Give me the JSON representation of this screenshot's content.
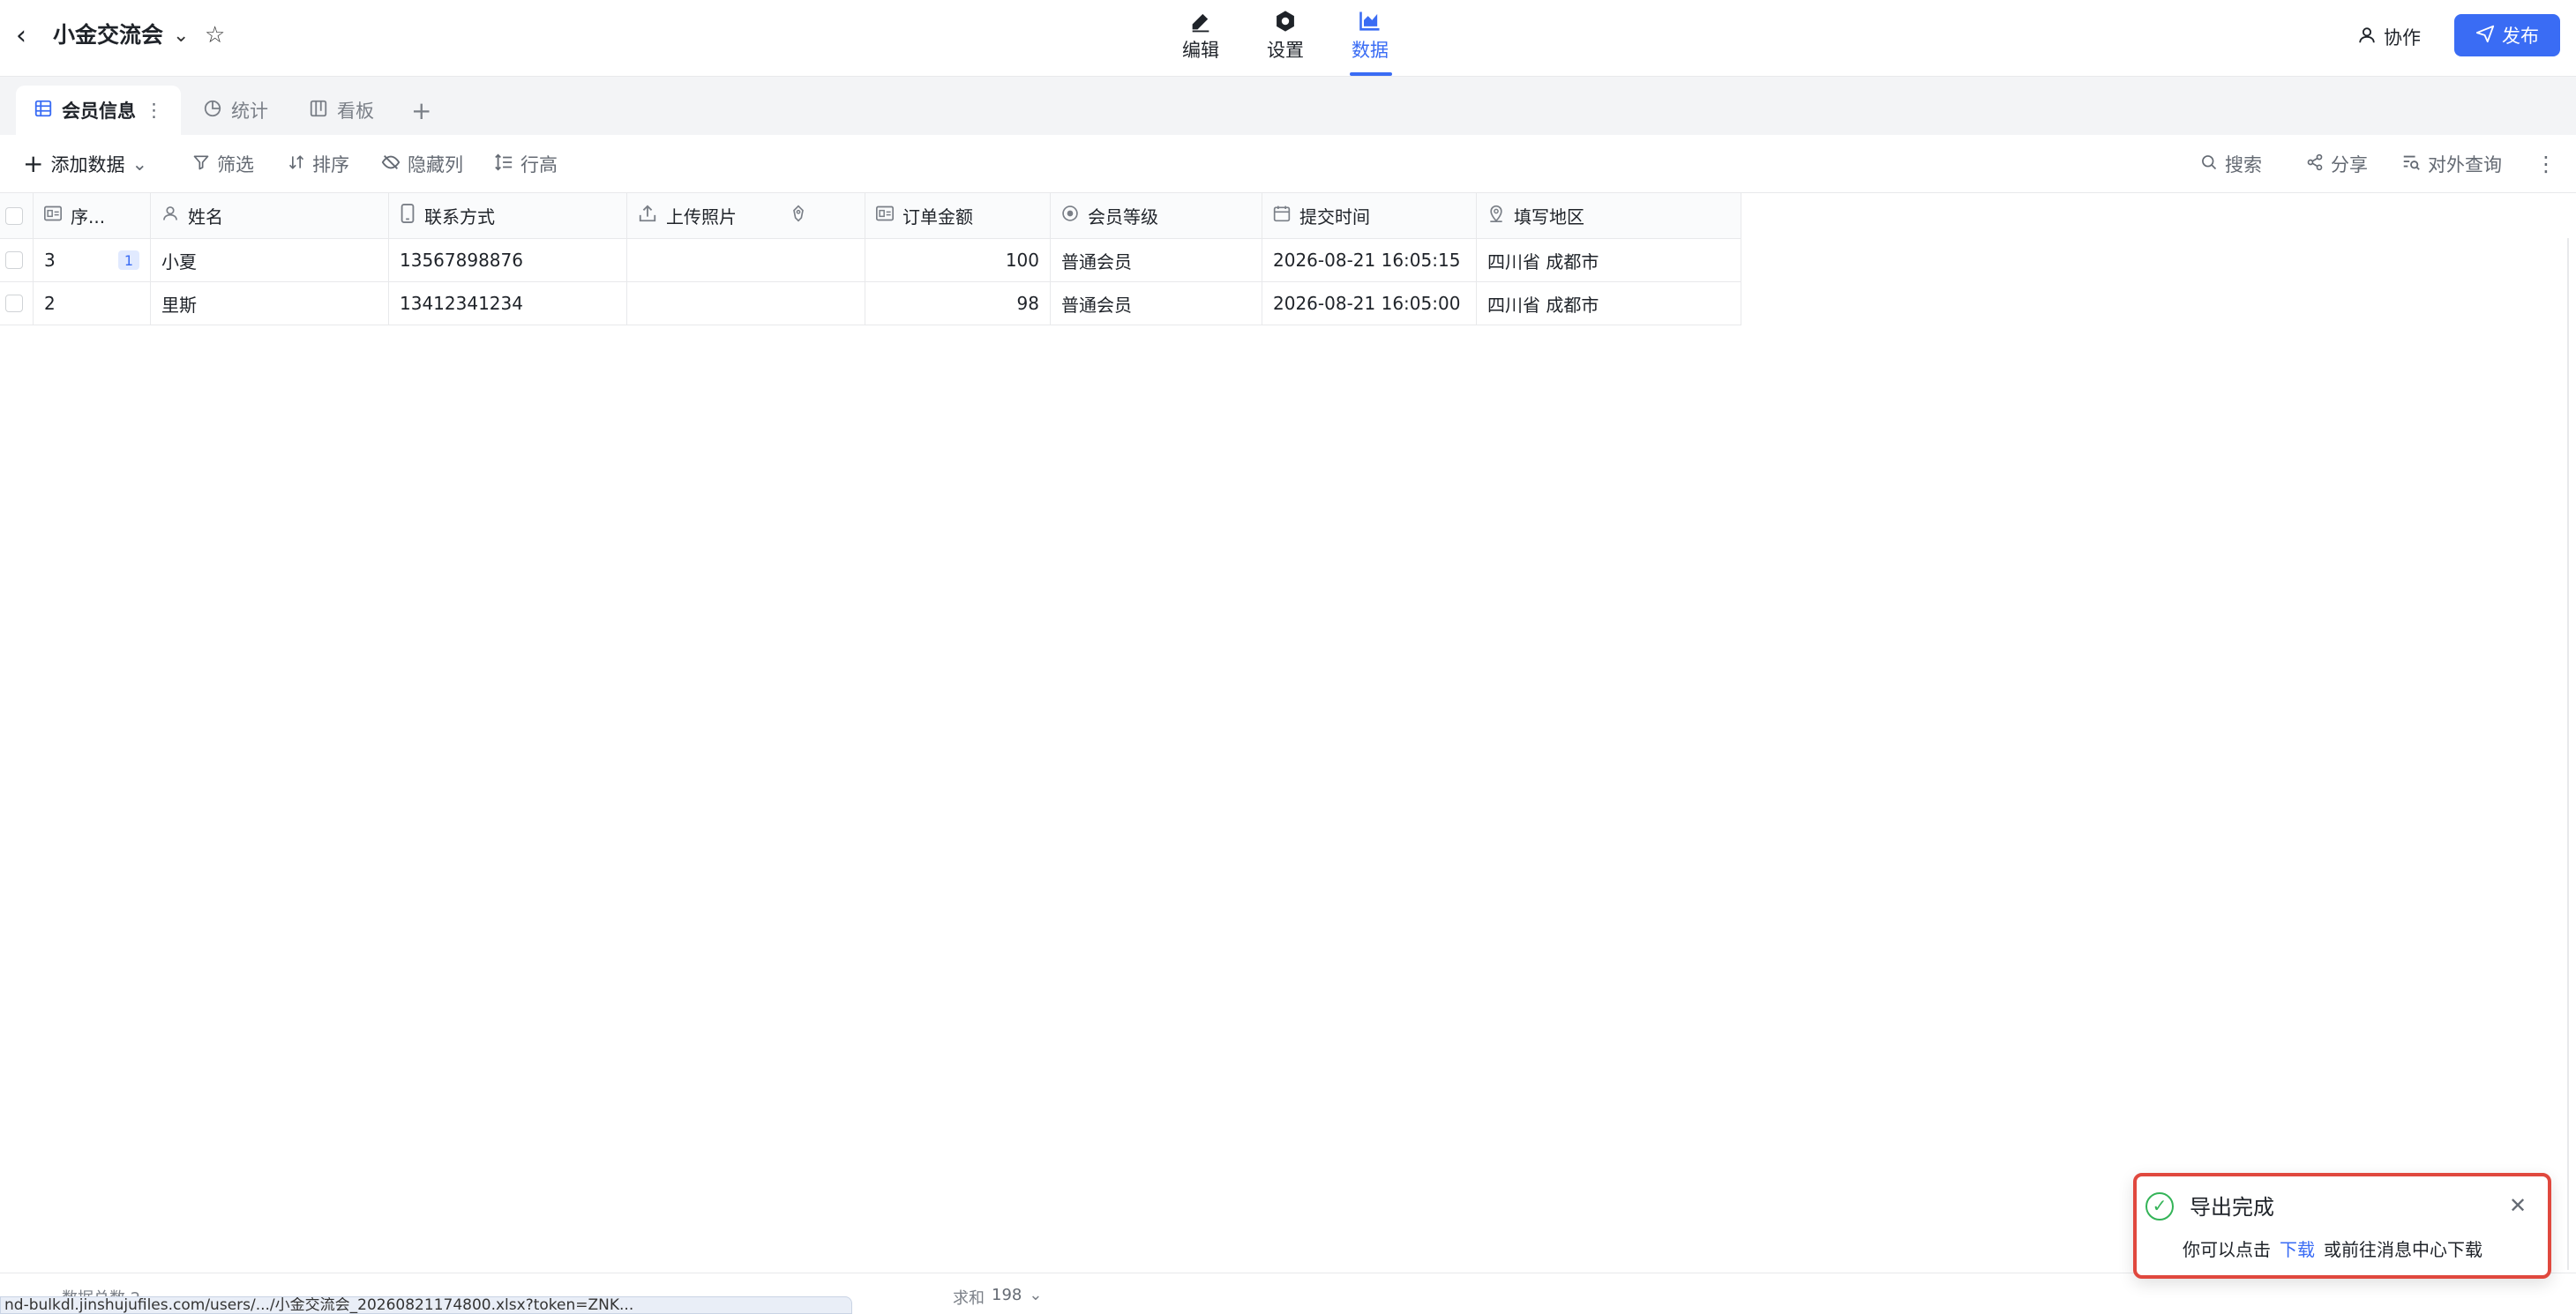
{
  "header": {
    "title": "小金交流会",
    "nav": [
      {
        "label": "编辑",
        "icon": "pencil-icon"
      },
      {
        "label": "设置",
        "icon": "gear-icon"
      },
      {
        "label": "数据",
        "icon": "chart-icon",
        "active": true
      }
    ],
    "collab_label": "协作",
    "publish_label": "发布"
  },
  "view_tabs": [
    {
      "label": "会员信息",
      "icon": "table-icon",
      "active": true
    },
    {
      "label": "统计",
      "icon": "pie-chart-icon"
    },
    {
      "label": "看板",
      "icon": "kanban-icon"
    }
  ],
  "toolbar": {
    "add_data": "添加数据",
    "filter": "筛选",
    "sort": "排序",
    "hide_columns": "隐藏列",
    "row_height": "行高",
    "search": "搜索",
    "share": "分享",
    "public_query": "对外查询"
  },
  "table": {
    "columns": [
      {
        "label": "序...",
        "icon": "id-card-icon"
      },
      {
        "label": "姓名",
        "icon": "person-icon"
      },
      {
        "label": "联系方式",
        "icon": "phone-icon"
      },
      {
        "label": "上传照片",
        "icon": "upload-icon"
      },
      {
        "label": "订单金额",
        "icon": "id-card-icon"
      },
      {
        "label": "会员等级",
        "icon": "radio-icon"
      },
      {
        "label": "提交时间",
        "icon": "calendar-icon"
      },
      {
        "label": "填写地区",
        "icon": "location-icon"
      }
    ],
    "rows": [
      {
        "seq": "3",
        "badge": "1",
        "name": "小夏",
        "phone": "13567898876",
        "photo": "",
        "amount": "100",
        "level": "普通会员",
        "time": "2026-08-21 16:05:15",
        "region": "四川省 成都市"
      },
      {
        "seq": "2",
        "badge": "",
        "name": "里斯",
        "phone": "13412341234",
        "photo": "",
        "amount": "98",
        "level": "普通会员",
        "time": "2026-08-21 16:05:00",
        "region": "四川省 成都市"
      }
    ]
  },
  "footer": {
    "count": "数据总数 2",
    "sum_label": "求和",
    "sum_value": "198"
  },
  "status_url": "nd-bulkdl.jinshujufiles.com/users/.../小金交流会_20260821174800.xlsx?token=ZNK...",
  "toast": {
    "title": "导出完成",
    "msg_prefix": "你可以点击",
    "link": "下载",
    "msg_suffix": "或前往消息中心下载"
  },
  "colors": {
    "accent": "#3a6cf4",
    "success": "#34b458",
    "highlight_border": "#e0483e"
  }
}
